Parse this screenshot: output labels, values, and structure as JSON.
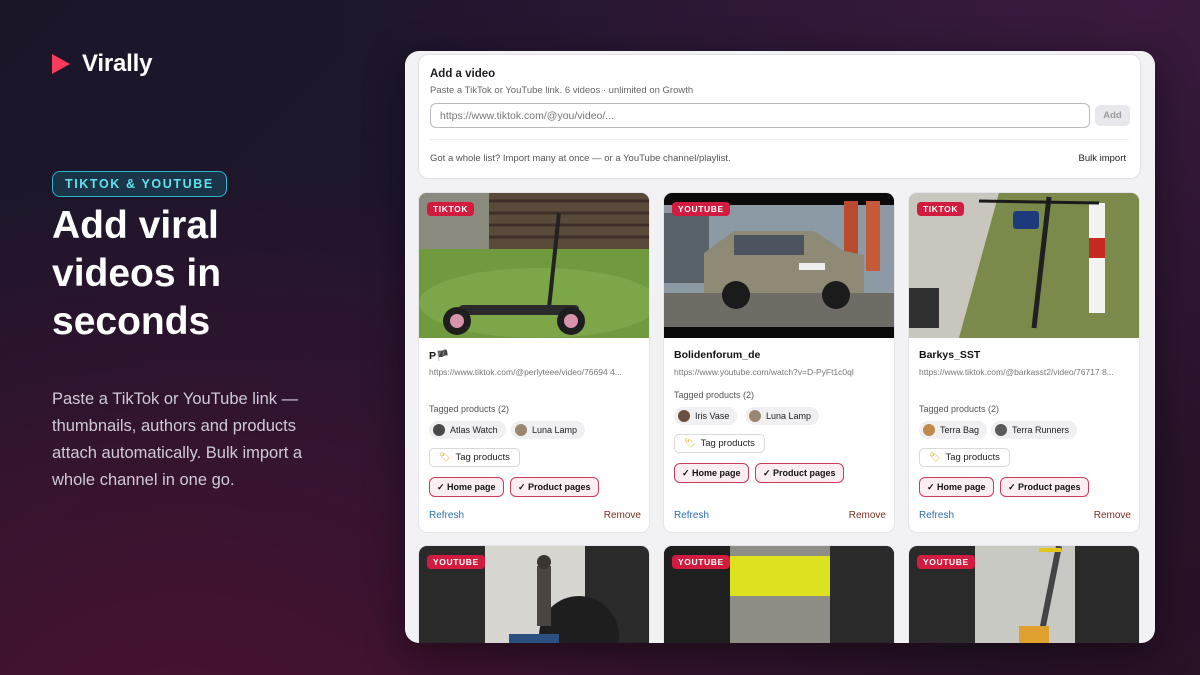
{
  "brand": {
    "name": "Virally",
    "accent": "#fb3a5c"
  },
  "hero": {
    "pill": "TIKTOK & YOUTUBE",
    "headline_lines": [
      "Add viral",
      "videos in",
      "seconds"
    ],
    "lead": "Paste a TikTok or YouTube link — thumbnails, authors and products attach automatically. Bulk import a whole channel in one go."
  },
  "add_video": {
    "title": "Add a video",
    "subtitle": "Paste a TikTok or YouTube link. 6 videos · unlimited on Growth",
    "placeholder": "https://www.tiktok.com/@you/video/...",
    "add_label": "Add",
    "bulk_note": "Got a whole list? Import many at once — or a YouTube channel/playlist.",
    "bulk_label": "Bulk import"
  },
  "cards": [
    {
      "platform": "TIKTOK",
      "author": "P🏴",
      "url": "https://www.tiktok.com/@perlyteee/video/76694 4...",
      "tagged_label": "Tagged products (2)",
      "products": [
        "Atlas Watch",
        "Luna Lamp"
      ],
      "tag_button": "Tag products",
      "locations": [
        "✓ Home page",
        "✓ Product pages"
      ],
      "refresh": "Refresh",
      "remove": "Remove"
    },
    {
      "platform": "YOUTUBE",
      "author": "Bolidenforum_de",
      "url": "https://www.youtube.com/watch?v=D-PyFt1c0ql",
      "tagged_label": "Tagged products (2)",
      "products": [
        "Iris Vase",
        "Luna Lamp"
      ],
      "tag_button": "Tag products",
      "locations": [
        "✓ Home page",
        "✓ Product pages"
      ],
      "refresh": "Refresh",
      "remove": "Remove"
    },
    {
      "platform": "TIKTOK",
      "author": "Barkys_SST",
      "url": "https://www.tiktok.com/@barkasst2/video/76717 8...",
      "tagged_label": "Tagged products (2)",
      "products": [
        "Terra Bag",
        "Terra Runners"
      ],
      "tag_button": "Tag products",
      "locations": [
        "✓ Home page",
        "✓ Product pages"
      ],
      "refresh": "Refresh",
      "remove": "Remove"
    }
  ],
  "lower_cards": [
    {
      "platform": "YOUTUBE"
    },
    {
      "platform": "YOUTUBE"
    },
    {
      "platform": "YOUTUBE"
    }
  ],
  "colors": {
    "badge": "#d21c3f",
    "pill_text": "#5fe3ef",
    "link": "#2b6fb0",
    "remove": "#7a2e22"
  }
}
